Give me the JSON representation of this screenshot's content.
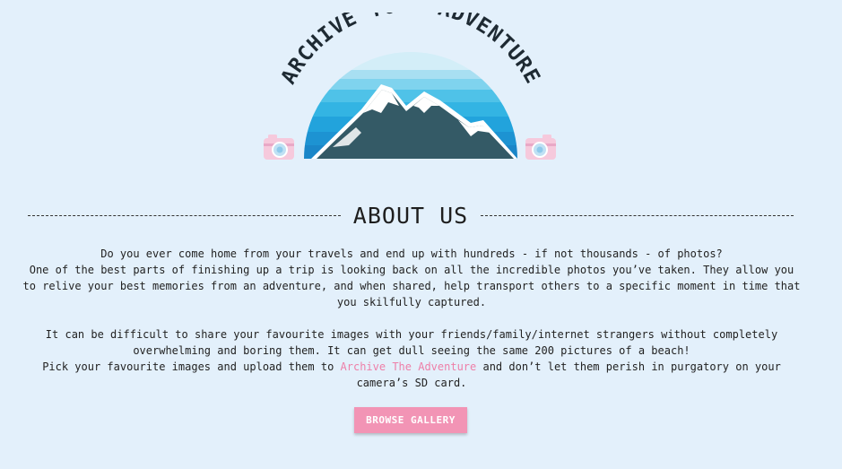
{
  "logo": {
    "text": "ARCHIVE YOUR ADVENTURE",
    "icons": [
      "camera-icon",
      "mountain-icon",
      "camera-icon"
    ],
    "colors": {
      "sky_top": "#bfe6f5",
      "sky_mid": "#5cc8ea",
      "sky_deep": "#1f8fd0",
      "mountain": "#345a66",
      "snow": "#ffffff",
      "camera": "#f6c9dc"
    }
  },
  "about": {
    "heading": "ABOUT US",
    "p1_l1": "Do you ever come home from your travels and end up with hundreds - if not thousands - of photos?",
    "p1_l2": "One of the best parts of finishing up a trip is looking back on all the incredible photos you’ve taken. They allow you to relive your best memories from an adventure, and when shared, help transport others to a specific moment in time that you skilfully captured.",
    "p2_l1": "It can be difficult to share your favourite images with your friends/family/internet strangers without completely overwhelming and boring them. It can get dull seeing the same 200 pictures of a beach!",
    "p2_l2_before": "Pick your favourite images and upload them to ",
    "p2_l2_link": "Archive The Adventure",
    "p2_l2_after": " and don’t let them perish in purgatory on your camera’s SD card."
  },
  "cta": {
    "label": "BROWSE GALLERY"
  },
  "colors": {
    "background": "#e3f0fb",
    "accent": "#f294b5",
    "link": "#ee7fa8"
  }
}
